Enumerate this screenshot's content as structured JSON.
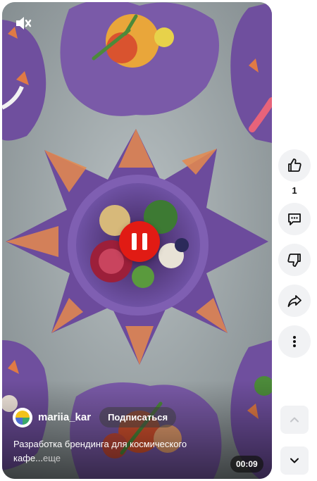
{
  "video": {
    "author_name": "mariia_kar",
    "subscribe_label": "Подписаться",
    "description": "Разработка брендинга для космического кафе...",
    "more_label": "еще",
    "duration": "00:09",
    "state": "playing",
    "muted": true
  },
  "actions": {
    "like_count": "1",
    "icons": [
      "thumbs-up-icon",
      "comment-icon",
      "thumbs-down-icon",
      "share-icon",
      "more-icon"
    ]
  },
  "nav": {
    "icons": [
      "chevron-up-icon",
      "chevron-down-icon"
    ]
  },
  "colors": {
    "accent_red": "#e11b14",
    "plate_purple": "#6b4a9c",
    "plate_orange": "#e58a4e",
    "table_gray": "#9ea7a9"
  }
}
